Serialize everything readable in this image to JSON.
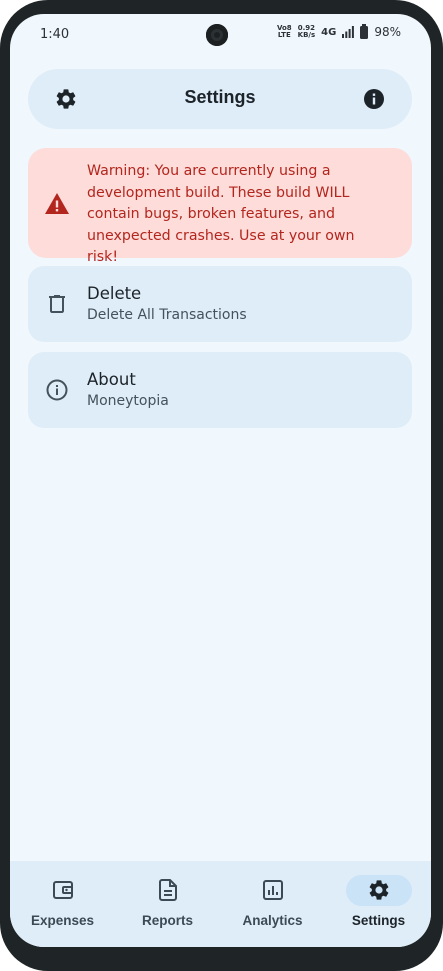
{
  "status_bar": {
    "time": "1:40",
    "volte_line1": "Vo8",
    "volte_line2": "LTE",
    "speed_value": "0.92",
    "speed_unit": "KB/s",
    "network": "4G",
    "battery": "98%"
  },
  "header": {
    "title": "Settings",
    "left_icon": "gear-icon",
    "right_icon": "info-icon"
  },
  "warning": {
    "text": "Warning: You are currently using a development build. These build WILL contain bugs, broken features, and unexpected crashes. Use at your own risk!",
    "icon": "warning-triangle-icon",
    "color": "#b3261e",
    "background": "#fddcd9"
  },
  "settings_items": [
    {
      "title": "Delete",
      "subtitle": "Delete All Transactions",
      "icon": "trash-icon"
    },
    {
      "title": "About",
      "subtitle": "Moneytopia",
      "icon": "info-outline-icon"
    }
  ],
  "bottom_nav": {
    "items": [
      {
        "label": "Expenses",
        "icon": "wallet-icon"
      },
      {
        "label": "Reports",
        "icon": "document-icon"
      },
      {
        "label": "Analytics",
        "icon": "analytics-icon"
      },
      {
        "label": "Settings",
        "icon": "gear-icon"
      }
    ],
    "active": "Settings"
  },
  "colors": {
    "background": "#f0f7fd",
    "surface": "#dfedf8",
    "active_pill": "#cbe3f7",
    "text": "#1c2329"
  }
}
